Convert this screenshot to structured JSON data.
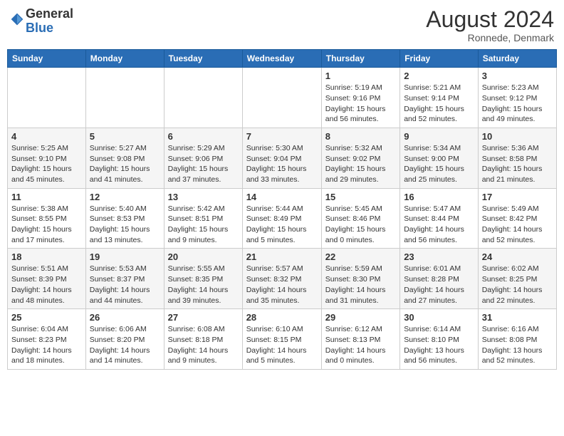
{
  "header": {
    "logo_general": "General",
    "logo_blue": "Blue",
    "month_year": "August 2024",
    "location": "Ronnede, Denmark"
  },
  "weekdays": [
    "Sunday",
    "Monday",
    "Tuesday",
    "Wednesday",
    "Thursday",
    "Friday",
    "Saturday"
  ],
  "weeks": [
    [
      {
        "day": "",
        "info": ""
      },
      {
        "day": "",
        "info": ""
      },
      {
        "day": "",
        "info": ""
      },
      {
        "day": "",
        "info": ""
      },
      {
        "day": "1",
        "info": "Sunrise: 5:19 AM\nSunset: 9:16 PM\nDaylight: 15 hours\nand 56 minutes."
      },
      {
        "day": "2",
        "info": "Sunrise: 5:21 AM\nSunset: 9:14 PM\nDaylight: 15 hours\nand 52 minutes."
      },
      {
        "day": "3",
        "info": "Sunrise: 5:23 AM\nSunset: 9:12 PM\nDaylight: 15 hours\nand 49 minutes."
      }
    ],
    [
      {
        "day": "4",
        "info": "Sunrise: 5:25 AM\nSunset: 9:10 PM\nDaylight: 15 hours\nand 45 minutes."
      },
      {
        "day": "5",
        "info": "Sunrise: 5:27 AM\nSunset: 9:08 PM\nDaylight: 15 hours\nand 41 minutes."
      },
      {
        "day": "6",
        "info": "Sunrise: 5:29 AM\nSunset: 9:06 PM\nDaylight: 15 hours\nand 37 minutes."
      },
      {
        "day": "7",
        "info": "Sunrise: 5:30 AM\nSunset: 9:04 PM\nDaylight: 15 hours\nand 33 minutes."
      },
      {
        "day": "8",
        "info": "Sunrise: 5:32 AM\nSunset: 9:02 PM\nDaylight: 15 hours\nand 29 minutes."
      },
      {
        "day": "9",
        "info": "Sunrise: 5:34 AM\nSunset: 9:00 PM\nDaylight: 15 hours\nand 25 minutes."
      },
      {
        "day": "10",
        "info": "Sunrise: 5:36 AM\nSunset: 8:58 PM\nDaylight: 15 hours\nand 21 minutes."
      }
    ],
    [
      {
        "day": "11",
        "info": "Sunrise: 5:38 AM\nSunset: 8:55 PM\nDaylight: 15 hours\nand 17 minutes."
      },
      {
        "day": "12",
        "info": "Sunrise: 5:40 AM\nSunset: 8:53 PM\nDaylight: 15 hours\nand 13 minutes."
      },
      {
        "day": "13",
        "info": "Sunrise: 5:42 AM\nSunset: 8:51 PM\nDaylight: 15 hours\nand 9 minutes."
      },
      {
        "day": "14",
        "info": "Sunrise: 5:44 AM\nSunset: 8:49 PM\nDaylight: 15 hours\nand 5 minutes."
      },
      {
        "day": "15",
        "info": "Sunrise: 5:45 AM\nSunset: 8:46 PM\nDaylight: 15 hours\nand 0 minutes."
      },
      {
        "day": "16",
        "info": "Sunrise: 5:47 AM\nSunset: 8:44 PM\nDaylight: 14 hours\nand 56 minutes."
      },
      {
        "day": "17",
        "info": "Sunrise: 5:49 AM\nSunset: 8:42 PM\nDaylight: 14 hours\nand 52 minutes."
      }
    ],
    [
      {
        "day": "18",
        "info": "Sunrise: 5:51 AM\nSunset: 8:39 PM\nDaylight: 14 hours\nand 48 minutes."
      },
      {
        "day": "19",
        "info": "Sunrise: 5:53 AM\nSunset: 8:37 PM\nDaylight: 14 hours\nand 44 minutes."
      },
      {
        "day": "20",
        "info": "Sunrise: 5:55 AM\nSunset: 8:35 PM\nDaylight: 14 hours\nand 39 minutes."
      },
      {
        "day": "21",
        "info": "Sunrise: 5:57 AM\nSunset: 8:32 PM\nDaylight: 14 hours\nand 35 minutes."
      },
      {
        "day": "22",
        "info": "Sunrise: 5:59 AM\nSunset: 8:30 PM\nDaylight: 14 hours\nand 31 minutes."
      },
      {
        "day": "23",
        "info": "Sunrise: 6:01 AM\nSunset: 8:28 PM\nDaylight: 14 hours\nand 27 minutes."
      },
      {
        "day": "24",
        "info": "Sunrise: 6:02 AM\nSunset: 8:25 PM\nDaylight: 14 hours\nand 22 minutes."
      }
    ],
    [
      {
        "day": "25",
        "info": "Sunrise: 6:04 AM\nSunset: 8:23 PM\nDaylight: 14 hours\nand 18 minutes."
      },
      {
        "day": "26",
        "info": "Sunrise: 6:06 AM\nSunset: 8:20 PM\nDaylight: 14 hours\nand 14 minutes."
      },
      {
        "day": "27",
        "info": "Sunrise: 6:08 AM\nSunset: 8:18 PM\nDaylight: 14 hours\nand 9 minutes."
      },
      {
        "day": "28",
        "info": "Sunrise: 6:10 AM\nSunset: 8:15 PM\nDaylight: 14 hours\nand 5 minutes."
      },
      {
        "day": "29",
        "info": "Sunrise: 6:12 AM\nSunset: 8:13 PM\nDaylight: 14 hours\nand 0 minutes."
      },
      {
        "day": "30",
        "info": "Sunrise: 6:14 AM\nSunset: 8:10 PM\nDaylight: 13 hours\nand 56 minutes."
      },
      {
        "day": "31",
        "info": "Sunrise: 6:16 AM\nSunset: 8:08 PM\nDaylight: 13 hours\nand 52 minutes."
      }
    ]
  ]
}
